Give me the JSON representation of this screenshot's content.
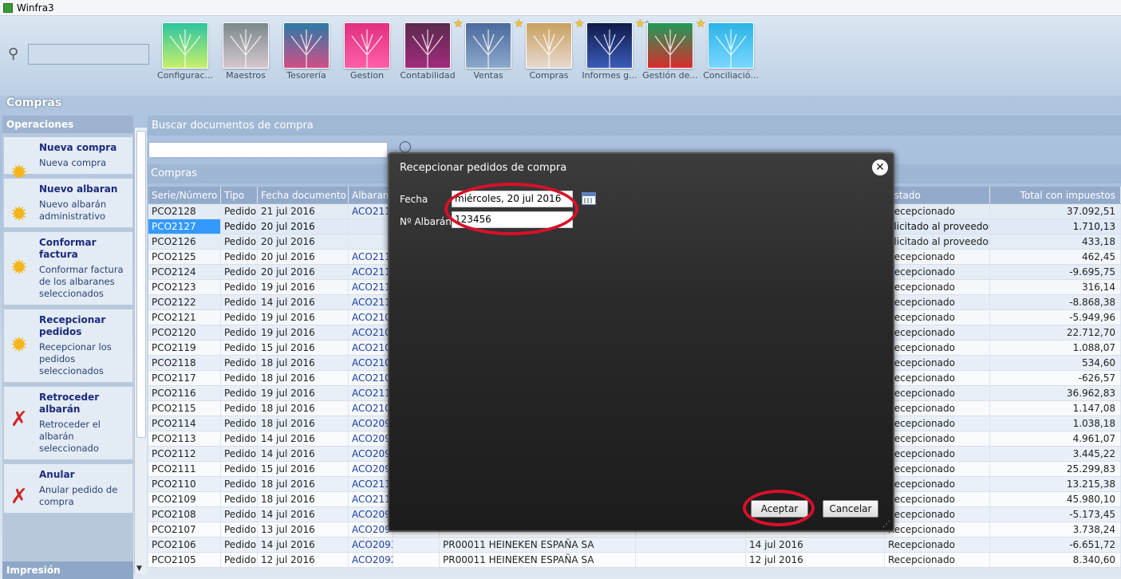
{
  "window": {
    "title": "Winfra3"
  },
  "modules": [
    {
      "label": "Configurac...",
      "star": false,
      "colors": [
        "#2ec4a0",
        "#c7f06a"
      ]
    },
    {
      "label": "Maestros",
      "star": false,
      "colors": [
        "#7b8a8c",
        "#d6c6cf"
      ]
    },
    {
      "label": "Tesorería",
      "star": false,
      "colors": [
        "#2b7aa8",
        "#d24f86"
      ]
    },
    {
      "label": "Gestion",
      "star": false,
      "colors": [
        "#e0307f",
        "#ff5fa8"
      ]
    },
    {
      "label": "Contabilidad",
      "star": false,
      "colors": [
        "#5a2a4e",
        "#a02b7c"
      ]
    },
    {
      "label": "Ventas",
      "star": true,
      "colors": [
        "#4b6a9c",
        "#8ca8cc"
      ]
    },
    {
      "label": "Compras",
      "star": true,
      "colors": [
        "#c9a05f",
        "#e7d9d0"
      ]
    },
    {
      "label": "Informes g...",
      "star": true,
      "colors": [
        "#0f1a4a",
        "#3a5bb8"
      ]
    },
    {
      "label": "Gestión de...",
      "star": true,
      "colors": [
        "#1f9a5a",
        "#d92d2d"
      ]
    },
    {
      "label": "Conciliació...",
      "star": true,
      "colors": [
        "#2ab4e6",
        "#7ad7ff"
      ]
    }
  ],
  "page": {
    "title": "Compras"
  },
  "left": {
    "operations_header": "Operaciones",
    "footer": "Impresión",
    "actions": [
      {
        "title": "Nueva compra",
        "desc": "Nueva compra",
        "icon": "sun-icon"
      },
      {
        "title": "Nuevo albaran",
        "desc": "Nuevo albarán administrativo",
        "icon": "sun-icon"
      },
      {
        "title": "Conformar factura",
        "desc": "Conformar factura de los albaranes seleccionados",
        "icon": "sun-icon"
      },
      {
        "title": "Recepcionar pedidos",
        "desc": "Recepcionar los pedidos seleccionados",
        "icon": "sun-icon"
      },
      {
        "title": "Retroceder albarán",
        "desc": "Retroceder el albarán seleccionado",
        "icon": "cross-icon"
      },
      {
        "title": "Anular",
        "desc": "Anular pedido de compra",
        "icon": "cross-icon"
      }
    ]
  },
  "main": {
    "search_header": "Buscar documentos de compra",
    "grid_header": "Compras",
    "columns": [
      "Serie/Número",
      "Tipo",
      "Fecha documento",
      "Albaran",
      "",
      "",
      "",
      "",
      "Estado",
      "Total con impuestos"
    ],
    "rows": [
      [
        "PCO2128",
        "Pedido",
        "21 jul 2016",
        "ACO211",
        "",
        "",
        "",
        "",
        "Recepcionado",
        "37.092,51"
      ],
      [
        "PCO2127",
        "Pedido",
        "20 jul 2016",
        "",
        "",
        "",
        "",
        "",
        "olicitado al proveedor",
        "1.710,13"
      ],
      [
        "PCO2126",
        "Pedido",
        "20 jul 2016",
        "",
        "",
        "",
        "",
        "",
        "olicitado al proveedor",
        "433,18"
      ],
      [
        "PCO2125",
        "Pedido",
        "20 jul 2016",
        "ACO211",
        "",
        "",
        "",
        "",
        "Recepcionado",
        "462,45"
      ],
      [
        "PCO2124",
        "Pedido",
        "20 jul 2016",
        "ACO211",
        "",
        "",
        "",
        "",
        "Recepcionado",
        "-9.695,75"
      ],
      [
        "PCO2123",
        "Pedido",
        "19 jul 2016",
        "ACO211",
        "",
        "",
        "",
        "",
        "Recepcionado",
        "316,14"
      ],
      [
        "PCO2122",
        "Pedido",
        "14 jul 2016",
        "ACO211",
        "",
        "",
        "",
        "",
        "Recepcionado",
        "-8.868,38"
      ],
      [
        "PCO2121",
        "Pedido",
        "19 jul 2016",
        "ACO210",
        "",
        "",
        "",
        "",
        "Recepcionado",
        "-5.949,96"
      ],
      [
        "PCO2120",
        "Pedido",
        "19 jul 2016",
        "ACO210",
        "",
        "",
        "",
        "",
        "Recepcionado",
        "22.712,70"
      ],
      [
        "PCO2119",
        "Pedido",
        "15 jul 2016",
        "ACO210",
        "",
        "",
        "",
        "",
        "Recepcionado",
        "1.088,07"
      ],
      [
        "PCO2118",
        "Pedido",
        "18 jul 2016",
        "ACO210",
        "",
        "",
        "",
        "",
        "Recepcionado",
        "534,60"
      ],
      [
        "PCO2117",
        "Pedido",
        "18 jul 2016",
        "ACO210",
        "",
        "",
        "",
        "",
        "Recepcionado",
        "-626,57"
      ],
      [
        "PCO2116",
        "Pedido",
        "19 jul 2016",
        "ACO211",
        "",
        "",
        "",
        "",
        "Recepcionado",
        "36.962,83"
      ],
      [
        "PCO2115",
        "Pedido",
        "18 jul 2016",
        "ACO210",
        "",
        "",
        "",
        "",
        "Recepcionado",
        "1.147,08"
      ],
      [
        "PCO2114",
        "Pedido",
        "18 jul 2016",
        "ACO209",
        "",
        "",
        "",
        "",
        "Recepcionado",
        "1.038,18"
      ],
      [
        "PCO2113",
        "Pedido",
        "14 jul 2016",
        "ACO209",
        "",
        "",
        "",
        "",
        "Recepcionado",
        "4.961,07"
      ],
      [
        "PCO2112",
        "Pedido",
        "14 jul 2016",
        "ACO209",
        "",
        "",
        "",
        "",
        "Recepcionado",
        "3.445,22"
      ],
      [
        "PCO2111",
        "Pedido",
        "15 jul 2016",
        "ACO209",
        "",
        "",
        "",
        "",
        "Recepcionado",
        "25.299,83"
      ],
      [
        "PCO2110",
        "Pedido",
        "18 jul 2016",
        "ACO211",
        "",
        "",
        "",
        "",
        "Recepcionado",
        "13.215,38"
      ],
      [
        "PCO2109",
        "Pedido",
        "18 jul 2016",
        "ACO211",
        "",
        "",
        "",
        "",
        "Recepcionado",
        "45.980,10"
      ],
      [
        "PCO2108",
        "Pedido",
        "14 jul 2016",
        "ACO209",
        "",
        "",
        "",
        "",
        "Recepcionado",
        "-5.173,45"
      ],
      [
        "PCO2107",
        "Pedido",
        "13 jul 2016",
        "ACO209",
        "",
        "",
        "",
        "",
        "Recepcionado",
        "3.738,24"
      ],
      [
        "PCO2106",
        "Pedido",
        "14 jul 2016",
        "ACO2093",
        "",
        "PR00011 HEINEKEN ESPAÑA SA",
        "",
        "14 jul 2016",
        "Recepcionado",
        "-6.651,72"
      ],
      [
        "PCO2105",
        "Pedido",
        "12 jul 2016",
        "ACO2092",
        "",
        "PR00011 HEINEKEN ESPAÑA SA",
        "",
        "12 jul 2016",
        "Recepcionado",
        "8.340,60"
      ]
    ],
    "selected_row": 1
  },
  "dialog": {
    "title": "Recepcionar pedidos de compra",
    "fecha_label": "Fecha",
    "fecha_value": "miércoles, 20 jul 2016",
    "albaran_label": "Nº Albarán",
    "albaran_value": "123456",
    "accept": "Aceptar",
    "cancel": "Cancelar"
  },
  "colors": {
    "highlight_oval": "#d8102a",
    "selection": "#3399ff"
  }
}
